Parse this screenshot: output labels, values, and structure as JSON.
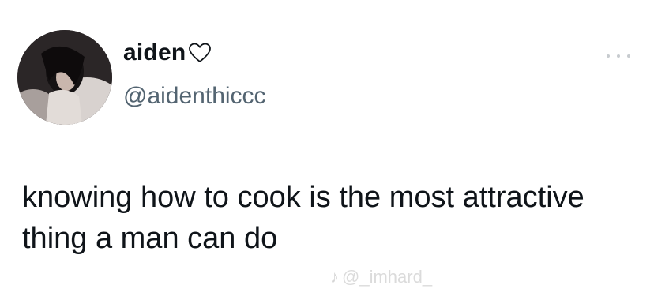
{
  "tweet": {
    "display_name": "aiden",
    "name_suffix_icon": "heart-outline-icon",
    "handle": "@aidenthiccc",
    "text": "knowing how to cook is the most attractive thing a man can do",
    "more_icon": "more-dots-icon"
  },
  "watermark": {
    "icon": "tiktok-icon",
    "text": "@_imhard_"
  },
  "colors": {
    "text": "#0f1419",
    "handle": "#536471",
    "background": "#ffffff"
  }
}
